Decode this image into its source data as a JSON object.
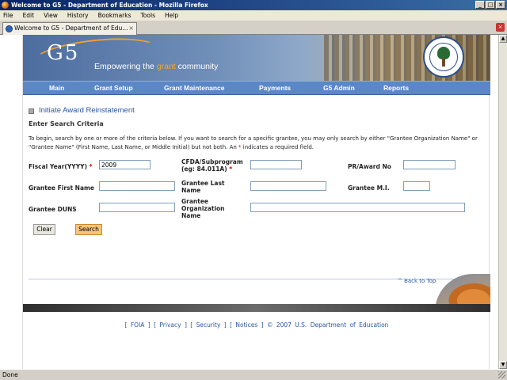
{
  "window": {
    "title": "Welcome to G5 - Department of Education - Mozilla Firefox"
  },
  "menu": [
    "File",
    "Edit",
    "View",
    "History",
    "Bookmarks",
    "Tools",
    "Help"
  ],
  "tab": {
    "label": "Welcome to G5 - Department of Edu..."
  },
  "banner": {
    "logo": "G5",
    "tagline_pre": "Empowering the ",
    "tagline_accent": "grant",
    "tagline_post": " community"
  },
  "nav": [
    "Main",
    "Grant Setup",
    "Grant Maintenance",
    "Payments",
    "G5 Admin",
    "Reports"
  ],
  "content": {
    "heading": "Initiate Award Reinstatement",
    "subheading": "Enter Search Criteria",
    "intro_a": "To begin, search by one or more of the criteria below. If you want to search for a specific grantee, you may only search by either \"Grantee Organization Name\" or \"Grantee Name\" (First Name, Last Name, or Middle Initial) but not both. An ",
    "intro_star": "*",
    "intro_b": " indicates a required field."
  },
  "form": {
    "fiscal_year_label": "Fiscal Year(YYYY)",
    "fiscal_year_value": "2009",
    "cfda_label_1": "CFDA/Subprogram",
    "cfda_label_2": "(eg: 84.011A)",
    "pr_award_label": "PR/Award No",
    "first_name_label": "Grantee First Name",
    "last_name_label_1": "Grantee Last",
    "last_name_label_2": "Name",
    "mi_label": "Grantee M.I.",
    "duns_label": "Grantee DUNS",
    "org_label_1": "Grantee",
    "org_label_2": "Organization",
    "org_label_3": "Name",
    "required_mark": "*"
  },
  "buttons": {
    "clear": "Clear",
    "search": "Search"
  },
  "back_to_top": "^ Back to Top",
  "footer": "[ FOIA ] [ Privacy ] [ Security ] [ Notices ]  © 2007 U.S. Department of Education",
  "status": "Done"
}
